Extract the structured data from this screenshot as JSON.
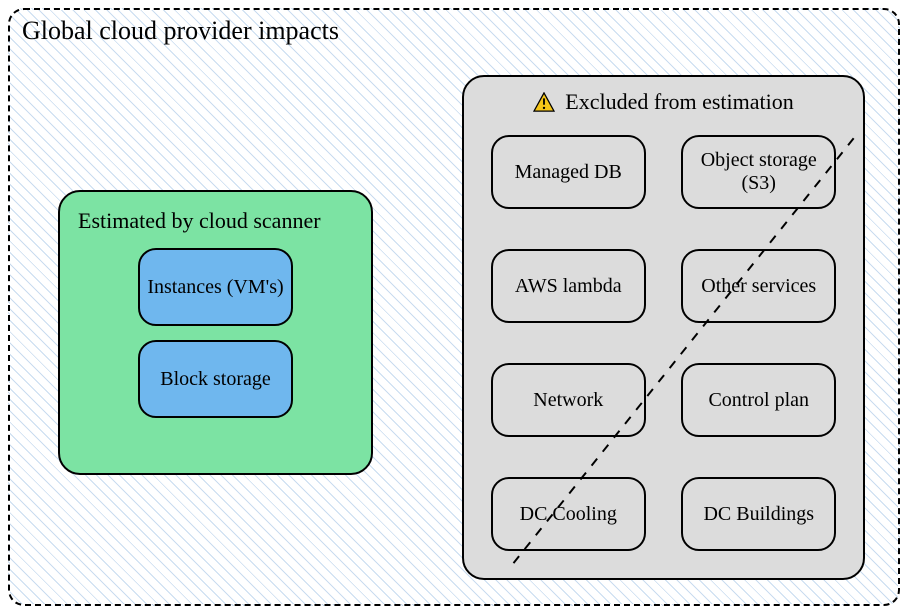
{
  "diagram": {
    "title": "Global cloud provider impacts",
    "estimated_panel": {
      "title": "Estimated by cloud scanner",
      "items": [
        "Instances (VM's)",
        "Block storage"
      ]
    },
    "excluded_panel": {
      "title": "Excluded from estimation",
      "icon": "warning-icon",
      "items": [
        "Managed DB",
        "Object storage (S3)",
        "AWS lambda",
        "Other services",
        "Network",
        "Control plan",
        "DC Cooling",
        "DC Buildings"
      ]
    }
  }
}
